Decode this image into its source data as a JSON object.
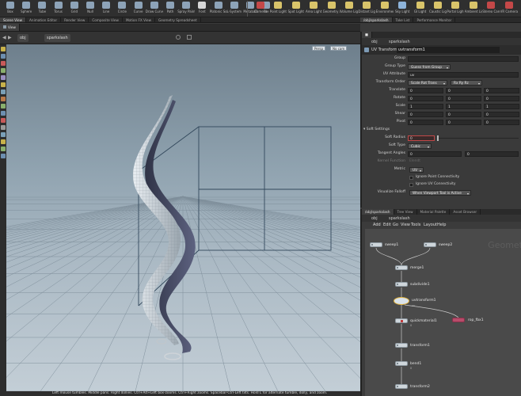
{
  "shelf": {
    "tools": [
      {
        "label": "Box",
        "icon": "box-icon",
        "color": "#8da3b8"
      },
      {
        "label": "Sphere",
        "icon": "sphere-icon",
        "color": "#8da3b8"
      },
      {
        "label": "Tube",
        "icon": "tube-icon",
        "color": "#8da3b8"
      },
      {
        "label": "Torus",
        "icon": "torus-icon",
        "color": "#8da3b8"
      },
      {
        "label": "Grid",
        "icon": "grid-icon",
        "color": "#8da3b8"
      },
      {
        "label": "Null",
        "icon": "null-icon",
        "color": "#8da3b8"
      },
      {
        "label": "Line",
        "icon": "line-icon",
        "color": "#8da3b8"
      },
      {
        "label": "Circle",
        "icon": "circle-icon",
        "color": "#8da3b8"
      },
      {
        "label": "Curve",
        "icon": "curve-icon",
        "color": "#8da3b8"
      },
      {
        "label": "Draw Curve",
        "icon": "draw-curve-icon",
        "color": "#8da3b8"
      },
      {
        "label": "Path",
        "icon": "path-icon",
        "color": "#8da3b8"
      },
      {
        "label": "Spray Paint",
        "icon": "spray-paint-icon",
        "color": "#8da3b8"
      },
      {
        "label": "Font",
        "icon": "font-icon",
        "color": "#d7d7d7"
      },
      {
        "label": "Platonic Solids",
        "icon": "platonic-solids-icon",
        "color": "#8da3b8"
      },
      {
        "label": "L-System",
        "icon": "l-system-icon",
        "color": "#8da3b8"
      },
      {
        "label": "Metaball",
        "icon": "metaball-icon",
        "color": "#8da3b8"
      },
      {
        "label": "File",
        "icon": "file-icon",
        "color": "#8da3b8"
      },
      {
        "label": "Camera",
        "icon": "camera-icon",
        "color": "#c44848"
      },
      {
        "label": "Point Light",
        "icon": "point-light-icon",
        "color": "#d9c46a"
      },
      {
        "label": "Spot Light",
        "icon": "spot-light-icon",
        "color": "#d9c46a"
      },
      {
        "label": "Area Light",
        "icon": "area-light-icon",
        "color": "#d9c46a"
      },
      {
        "label": "Geometry Light",
        "icon": "geometry-light-icon",
        "color": "#d9c46a"
      },
      {
        "label": "Volume Light",
        "icon": "volume-light-icon",
        "color": "#d9c46a"
      },
      {
        "label": "Distant Light",
        "icon": "distant-light-icon",
        "color": "#d9c46a"
      },
      {
        "label": "Environment Light",
        "icon": "environment-light-icon",
        "color": "#d9c46a"
      },
      {
        "label": "Sky Light",
        "icon": "sky-light-icon",
        "color": "#8db3d9"
      },
      {
        "label": "GI Light",
        "icon": "gi-light-icon",
        "color": "#d9c46a"
      },
      {
        "label": "Caustic Light",
        "icon": "caustic-light-icon",
        "color": "#d9c46a"
      },
      {
        "label": "Portal Light",
        "icon": "portal-light-icon",
        "color": "#d9c46a"
      },
      {
        "label": "Ambient Light",
        "icon": "ambient-light-icon",
        "color": "#d9c46a"
      },
      {
        "label": "Stereo Camera",
        "icon": "stereo-camera-icon",
        "color": "#c44848"
      },
      {
        "label": "VR Camera",
        "icon": "vr-camera-icon",
        "color": "#c44848"
      }
    ]
  },
  "tabs_left": [
    "Scene View",
    "Animation Editor",
    "Render View",
    "Composite View",
    "Motion FX View",
    "Geometry Spreadsheet"
  ],
  "tabs_right": [
    "/obj/sparkslash",
    "Take List",
    "Performance Monitor"
  ],
  "viewport": {
    "title": "View",
    "path_root": "obj",
    "path_node": "sparkslash",
    "persp_label": "Persp",
    "cam_label": "No cam",
    "status": "Left mouse tumbles. Middle pans. Right dollies. Ctrl+Alt+Left box-zooms. Ctrl+Right zooms. Spacebar-Ctrl-Left tilts. Hold L for alternate tumble, dolly, and zoom."
  },
  "params": {
    "path_root": "obj",
    "path_node": "sparkslash",
    "node_type": "UV Transform",
    "node_name": "uvtransform1",
    "rows": {
      "group": "Group",
      "group_type": {
        "label": "Group Type",
        "value": "Guess from Group"
      },
      "uv_attribute": {
        "label": "UV Attribute",
        "value": "uv"
      },
      "transform_order": {
        "label": "Transform Order",
        "value": "Scale Rot Trans",
        "value2": "Rx Ry Rz"
      },
      "translate": {
        "label": "Translate",
        "v": [
          "0",
          "0",
          "0"
        ]
      },
      "rotate": {
        "label": "Rotate",
        "v": [
          "0",
          "0",
          "0"
        ]
      },
      "scale": {
        "label": "Scale",
        "v": [
          "1",
          "1",
          "1"
        ]
      },
      "shear": {
        "label": "Shear",
        "v": [
          "0",
          "0",
          "0"
        ]
      },
      "pivot": {
        "label": "Pivot",
        "v": [
          "0",
          "0",
          "0"
        ]
      },
      "soft_settings": "Soft Settings",
      "soft_radius": {
        "label": "Soft Radius",
        "value": "0"
      },
      "soft_type": {
        "label": "Soft Type",
        "value": "Cubic"
      },
      "tangent_angles": {
        "label": "Tangent Angles",
        "v": [
          "0",
          "0"
        ]
      },
      "kernel_function": {
        "label": "Kernel Function",
        "value": "Elendt"
      },
      "metric": {
        "label": "Metric",
        "value": "UV"
      },
      "ignore_point": "Ignore Point Connectivity",
      "ignore_uv": "Ignore UV Connectivity",
      "visualize_falloff": {
        "label": "Visualize Falloff",
        "value": "When Viewport Tool is Active"
      }
    }
  },
  "network": {
    "tabs": [
      "/obj/sparkslash",
      "Tree View",
      "Material Palette",
      "Asset Browser"
    ],
    "path_root": "obj",
    "path_node": "sparkslash",
    "menu": [
      "Add",
      "Edit",
      "Go",
      "View",
      "Tools",
      "Layout",
      "Help"
    ],
    "watermark": "Geomet",
    "nodes": [
      {
        "name": "sweep1"
      },
      {
        "name": "sweep2"
      },
      {
        "name": "merge1"
      },
      {
        "name": "subdivide1"
      },
      {
        "name": "uvtransform1",
        "sub": "uv"
      },
      {
        "name": "quickmaterial1",
        "sub": "0"
      },
      {
        "name": "rop_fbx1"
      },
      {
        "name": "transform1"
      },
      {
        "name": "bend1",
        "sub": "0"
      },
      {
        "name": "transform2"
      }
    ]
  }
}
